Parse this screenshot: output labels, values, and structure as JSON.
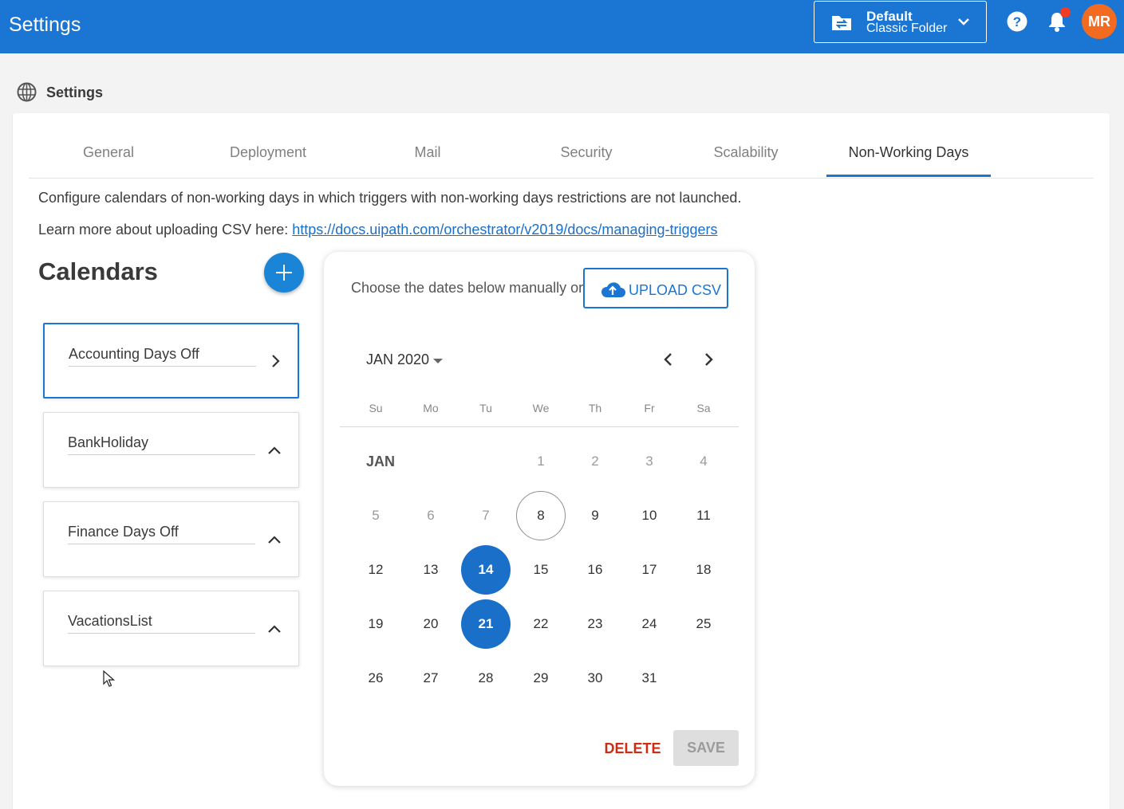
{
  "header": {
    "title": "Settings",
    "folder": {
      "name": "Default",
      "type": "Classic Folder",
      "icon": "folder-swap-icon"
    },
    "help_icon": "help-icon",
    "notifications_icon": "bell-icon",
    "avatar_initials": "MR",
    "colors": {
      "bar": "#1a76d2",
      "avatar": "#f36b21",
      "badge": "#ef3c24"
    }
  },
  "breadcrumb": {
    "icon": "globe-icon",
    "label": "Settings"
  },
  "tabs": [
    {
      "label": "General"
    },
    {
      "label": "Deployment"
    },
    {
      "label": "Mail"
    },
    {
      "label": "Security"
    },
    {
      "label": "Scalability"
    },
    {
      "label": "Non-Working Days",
      "active": true
    }
  ],
  "content": {
    "description": "Configure calendars of non-working days in which triggers with non-working days restrictions are not launched.",
    "learn_more_prefix": "Learn more about uploading CSV here: ",
    "learn_more_link": "https://docs.uipath.com/orchestrator/v2019/docs/managing-triggers"
  },
  "calendars": {
    "title": "Calendars",
    "add_icon": "plus-icon",
    "items": [
      {
        "name": "Accounting Days Off",
        "selected": true,
        "icon": "chevron-right-icon"
      },
      {
        "name": "BankHoliday",
        "selected": false,
        "icon": "chevron-up-icon"
      },
      {
        "name": "Finance Days Off",
        "selected": false,
        "icon": "chevron-up-icon"
      },
      {
        "name": "VacationsList",
        "selected": false,
        "icon": "chevron-up-icon"
      }
    ]
  },
  "picker": {
    "choose_text": "Choose the dates below manually or",
    "upload_label": "UPLOAD CSV",
    "upload_icon": "cloud-upload-icon",
    "month_label": "JAN 2020",
    "month_tag": "JAN",
    "weekdays": [
      "Su",
      "Mo",
      "Tu",
      "We",
      "Th",
      "Fr",
      "Sa"
    ],
    "first_weekday_index": 3,
    "days_in_month": 31,
    "faded_days": [
      1,
      2,
      3,
      4,
      5,
      6,
      7
    ],
    "today": 8,
    "selected_days": [
      14,
      21
    ],
    "delete_label": "DELETE",
    "save_label": "SAVE",
    "accent_color": "#1a6fc9"
  }
}
